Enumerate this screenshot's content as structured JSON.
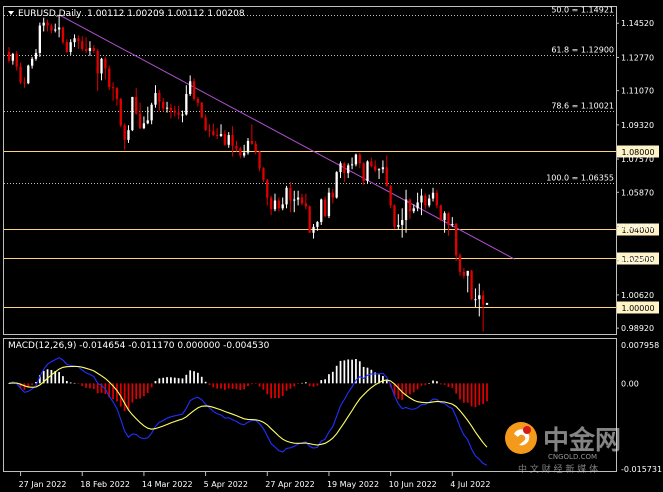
{
  "colors": {
    "background": "#000000",
    "axis": "#bfbfbf",
    "bull_candle": "#ffffff",
    "bear_candle": "#e00000",
    "fib_line": "#bfbfbf",
    "sr_line": "#ffd27a",
    "trendline": "#b050d0",
    "macd_hist_pos": "#ffffff",
    "macd_hist_neg": "#e00000",
    "macd_line": "#2030ff",
    "signal_line": "#ffff66",
    "logo_orange": "#f39a1a",
    "logo_red": "#d61a1a"
  },
  "price_panel": {
    "header": "EURUSD,Daily  1.00112 1.00209 1.00112 1.00208",
    "y_ticks": [
      "1.14520",
      "1.12770",
      "1.11070",
      "1.09320",
      "1.07570",
      "1.05870",
      "1.04120",
      "1.02370",
      "1.00620",
      "0.98920"
    ]
  },
  "macd_panel": {
    "header": "MACD(12,26,9) -0.014654 -0.011170 0.000000 -0.004530",
    "y_ticks": [
      "0.007958",
      "0.00",
      "-0.015731"
    ]
  },
  "x_ticks": [
    "27 Jan 2022",
    "18 Feb 2022",
    "14 Mar 2022",
    "5 Apr 2022",
    "27 Apr 2022",
    "19 May 2022",
    "10 Jun 2022",
    "4 Jul 2022"
  ],
  "fib_levels": [
    {
      "label": "50.0 = 1.14921",
      "value": 1.14921
    },
    {
      "label": "61.8 = 1.12900",
      "value": 1.129
    },
    {
      "label": "78.6 = 1.10021",
      "value": 1.10021
    },
    {
      "label": "100.0 = 1.06355",
      "value": 1.06355
    }
  ],
  "sr_levels": [
    {
      "label": "1.08000",
      "value": 1.08
    },
    {
      "label": "1.04000",
      "value": 1.04
    },
    {
      "label": "1.02500",
      "value": 1.025
    },
    {
      "label": "1.00000",
      "value": 1.0
    }
  ],
  "watermark": {
    "brand": "中金网",
    "domain": "CNGOLD.COM",
    "tagline": "中 文 财 经 新 媒 体"
  },
  "chart_data": {
    "type": "candlestick",
    "symbol": "EURUSD",
    "timeframe": "Daily",
    "last_ohlc": {
      "open": 1.00112,
      "high": 1.00209,
      "low": 1.00112,
      "close": 1.00208
    },
    "price_range": [
      0.9862,
      1.1535
    ],
    "trendline": {
      "from": {
        "date": "2022-02-10",
        "price": 1.1495
      },
      "to": {
        "date": "2022-07-25",
        "price": 1.0245
      }
    },
    "candles": [
      [
        "2022-01-24",
        1.1305,
        1.133,
        1.125,
        1.126
      ],
      [
        "2022-01-25",
        1.126,
        1.13,
        1.124,
        1.1295
      ],
      [
        "2022-01-26",
        1.1295,
        1.131,
        1.121,
        1.123
      ],
      [
        "2022-01-27",
        1.123,
        1.125,
        1.114,
        1.115
      ],
      [
        "2022-01-28",
        1.115,
        1.1175,
        1.1122,
        1.1145
      ],
      [
        "2022-01-31",
        1.1145,
        1.124,
        1.114,
        1.1235
      ],
      [
        "2022-02-01",
        1.1235,
        1.128,
        1.122,
        1.127
      ],
      [
        "2022-02-02",
        1.127,
        1.132,
        1.126,
        1.13
      ],
      [
        "2022-02-03",
        1.13,
        1.1455,
        1.128,
        1.144
      ],
      [
        "2022-02-04",
        1.144,
        1.148,
        1.141,
        1.1455
      ],
      [
        "2022-02-07",
        1.1455,
        1.147,
        1.141,
        1.144
      ],
      [
        "2022-02-08",
        1.144,
        1.145,
        1.14,
        1.1415
      ],
      [
        "2022-02-09",
        1.1415,
        1.145,
        1.1405,
        1.142
      ],
      [
        "2022-02-10",
        1.142,
        1.1495,
        1.138,
        1.143
      ],
      [
        "2022-02-11",
        1.143,
        1.1435,
        1.1345,
        1.1355
      ],
      [
        "2022-02-14",
        1.1355,
        1.137,
        1.13,
        1.1305
      ],
      [
        "2022-02-15",
        1.1305,
        1.137,
        1.129,
        1.1355
      ],
      [
        "2022-02-16",
        1.1355,
        1.1395,
        1.133,
        1.1375
      ],
      [
        "2022-02-17",
        1.1375,
        1.139,
        1.132,
        1.136
      ],
      [
        "2022-02-18",
        1.136,
        1.1385,
        1.131,
        1.132
      ],
      [
        "2022-02-21",
        1.132,
        1.138,
        1.13,
        1.131
      ],
      [
        "2022-02-22",
        1.131,
        1.136,
        1.1285,
        1.1325
      ],
      [
        "2022-02-23",
        1.1325,
        1.134,
        1.13,
        1.131
      ],
      [
        "2022-02-24",
        1.131,
        1.132,
        1.1105,
        1.1195
      ],
      [
        "2022-02-25",
        1.1195,
        1.1275,
        1.116,
        1.127
      ],
      [
        "2022-02-28",
        1.127,
        1.128,
        1.1165,
        1.122
      ],
      [
        "2022-03-01",
        1.122,
        1.1235,
        1.111,
        1.1125
      ],
      [
        "2022-03-02",
        1.1125,
        1.115,
        1.1055,
        1.112
      ],
      [
        "2022-03-03",
        1.112,
        1.1125,
        1.103,
        1.1065
      ],
      [
        "2022-03-04",
        1.1065,
        1.107,
        1.092,
        1.093
      ],
      [
        "2022-03-07",
        1.093,
        1.094,
        1.0805,
        1.0855
      ],
      [
        "2022-03-08",
        1.0855,
        1.093,
        1.084,
        1.0905
      ],
      [
        "2022-03-09",
        1.0905,
        1.1075,
        1.09,
        1.1075
      ],
      [
        "2022-03-10",
        1.1075,
        1.112,
        1.0985,
        1.099
      ],
      [
        "2022-03-11",
        1.099,
        1.1045,
        1.091,
        1.0915
      ],
      [
        "2022-03-14",
        1.0915,
        1.0975,
        1.091,
        1.094
      ],
      [
        "2022-03-15",
        1.094,
        1.1025,
        1.0935,
        1.0955
      ],
      [
        "2022-03-16",
        1.0955,
        1.1045,
        1.0935,
        1.1035
      ],
      [
        "2022-03-17",
        1.1035,
        1.1135,
        1.102,
        1.1095
      ],
      [
        "2022-03-18",
        1.1095,
        1.111,
        1.1005,
        1.105
      ],
      [
        "2022-03-21",
        1.105,
        1.107,
        1.1,
        1.1015
      ],
      [
        "2022-03-22",
        1.1015,
        1.105,
        1.0995,
        1.102
      ],
      [
        "2022-03-23",
        1.102,
        1.104,
        1.0965,
        1.1005
      ],
      [
        "2022-03-24",
        1.1005,
        1.103,
        1.0975,
        1.0995
      ],
      [
        "2022-03-25",
        1.0995,
        1.103,
        1.096,
        1.0985
      ],
      [
        "2022-03-28",
        1.0985,
        1.1005,
        1.0945,
        1.0985
      ],
      [
        "2022-03-29",
        1.0985,
        1.1135,
        1.098,
        1.109
      ],
      [
        "2022-03-30",
        1.109,
        1.1185,
        1.108,
        1.1155
      ],
      [
        "2022-03-31",
        1.1155,
        1.117,
        1.1055,
        1.1065
      ],
      [
        "2022-04-01",
        1.1065,
        1.1075,
        1.1025,
        1.1045
      ],
      [
        "2022-04-04",
        1.1045,
        1.105,
        1.0965,
        1.097
      ],
      [
        "2022-04-05",
        1.097,
        1.0985,
        1.09,
        1.0905
      ],
      [
        "2022-04-06",
        1.0905,
        1.0935,
        1.087,
        1.09
      ],
      [
        "2022-04-07",
        1.09,
        1.094,
        1.0875,
        1.088
      ],
      [
        "2022-04-08",
        1.088,
        1.0915,
        1.086,
        1.0875
      ],
      [
        "2022-04-11",
        1.0875,
        1.0935,
        1.087,
        1.0885
      ],
      [
        "2022-04-12",
        1.0885,
        1.0905,
        1.0825,
        1.083
      ],
      [
        "2022-04-13",
        1.083,
        1.0895,
        1.0815,
        1.088
      ],
      [
        "2022-04-14",
        1.088,
        1.0925,
        1.077,
        1.0825
      ],
      [
        "2022-04-15",
        1.0825,
        1.085,
        1.0795,
        1.081
      ],
      [
        "2022-04-18",
        1.081,
        1.082,
        1.076,
        1.0775
      ],
      [
        "2022-04-19",
        1.0775,
        1.083,
        1.0765,
        1.079
      ],
      [
        "2022-04-20",
        1.079,
        1.0865,
        1.078,
        1.085
      ],
      [
        "2022-04-21",
        1.085,
        1.0935,
        1.083,
        1.0835
      ],
      [
        "2022-04-22",
        1.0835,
        1.085,
        1.078,
        1.0795
      ],
      [
        "2022-04-25",
        1.0795,
        1.08,
        1.0695,
        1.071
      ],
      [
        "2022-04-26",
        1.071,
        1.0715,
        1.064,
        1.065
      ],
      [
        "2022-04-27",
        1.065,
        1.0655,
        1.052,
        1.056
      ],
      [
        "2022-04-28",
        1.056,
        1.057,
        1.047,
        1.05
      ],
      [
        "2022-04-29",
        1.05,
        1.058,
        1.049,
        1.0545
      ],
      [
        "2022-05-02",
        1.0545,
        1.056,
        1.049,
        1.0505
      ],
      [
        "2022-05-03",
        1.0505,
        1.056,
        1.0495,
        1.0525
      ],
      [
        "2022-05-04",
        1.0525,
        1.062,
        1.0505,
        1.061
      ],
      [
        "2022-05-05",
        1.061,
        1.064,
        1.0485,
        1.0545
      ],
      [
        "2022-05-06",
        1.0545,
        1.0595,
        1.0485,
        1.055
      ],
      [
        "2022-05-09",
        1.055,
        1.0595,
        1.052,
        1.056
      ],
      [
        "2022-05-10",
        1.056,
        1.058,
        1.052,
        1.053
      ],
      [
        "2022-05-11",
        1.053,
        1.058,
        1.05,
        1.0515
      ],
      [
        "2022-05-12",
        1.0515,
        1.052,
        1.038,
        1.038
      ],
      [
        "2022-05-13",
        1.038,
        1.0425,
        1.035,
        1.041
      ],
      [
        "2022-05-16",
        1.041,
        1.044,
        1.039,
        1.0435
      ],
      [
        "2022-05-17",
        1.0435,
        1.0555,
        1.042,
        1.055
      ],
      [
        "2022-05-18",
        1.055,
        1.0565,
        1.046,
        1.0465
      ],
      [
        "2022-05-19",
        1.0465,
        1.061,
        1.0455,
        1.0585
      ],
      [
        "2022-05-20",
        1.0585,
        1.0605,
        1.053,
        1.056
      ],
      [
        "2022-05-23",
        1.056,
        1.0695,
        1.0555,
        1.069
      ],
      [
        "2022-05-24",
        1.069,
        1.0745,
        1.066,
        1.0735
      ],
      [
        "2022-05-25",
        1.0735,
        1.074,
        1.064,
        1.0685
      ],
      [
        "2022-05-26",
        1.0685,
        1.0735,
        1.066,
        1.0725
      ],
      [
        "2022-05-27",
        1.0725,
        1.0765,
        1.0705,
        1.073
      ],
      [
        "2022-05-30",
        1.073,
        1.0785,
        1.072,
        1.078
      ],
      [
        "2022-05-31",
        1.078,
        1.079,
        1.071,
        1.0735
      ],
      [
        "2022-06-01",
        1.0735,
        1.074,
        1.0625,
        1.0645
      ],
      [
        "2022-06-02",
        1.0645,
        1.075,
        1.063,
        1.0745
      ],
      [
        "2022-06-03",
        1.0745,
        1.0765,
        1.0715,
        1.072
      ],
      [
        "2022-06-06",
        1.072,
        1.075,
        1.069,
        1.07
      ],
      [
        "2022-06-07",
        1.07,
        1.071,
        1.0655,
        1.0705
      ],
      [
        "2022-06-08",
        1.0705,
        1.075,
        1.0685,
        1.0715
      ],
      [
        "2022-06-09",
        1.0715,
        1.0775,
        1.0615,
        1.062
      ],
      [
        "2022-06-10",
        1.062,
        1.0625,
        1.0505,
        1.052
      ],
      [
        "2022-06-13",
        1.052,
        1.0525,
        1.04,
        1.041
      ],
      [
        "2022-06-14",
        1.041,
        1.0475,
        1.0395,
        1.042
      ],
      [
        "2022-06-15",
        1.042,
        1.0505,
        1.0355,
        1.0445
      ],
      [
        "2022-06-16",
        1.0445,
        1.06,
        1.038,
        1.055
      ],
      [
        "2022-06-17",
        1.055,
        1.0555,
        1.045,
        1.049
      ],
      [
        "2022-06-20",
        1.049,
        1.0525,
        1.048,
        1.0505
      ],
      [
        "2022-06-21",
        1.0505,
        1.0585,
        1.049,
        1.0535
      ],
      [
        "2022-06-22",
        1.0535,
        1.0605,
        1.047,
        1.057
      ],
      [
        "2022-06-23",
        1.057,
        1.058,
        1.05,
        1.052
      ],
      [
        "2022-06-24",
        1.052,
        1.0575,
        1.051,
        1.0555
      ],
      [
        "2022-06-27",
        1.0555,
        1.061,
        1.054,
        1.0585
      ],
      [
        "2022-06-28",
        1.0585,
        1.06,
        1.0505,
        1.052
      ],
      [
        "2022-06-29",
        1.052,
        1.0525,
        1.044,
        1.0445
      ],
      [
        "2022-06-30",
        1.0445,
        1.049,
        1.038,
        1.048
      ],
      [
        "2022-07-01",
        1.048,
        1.0485,
        1.0365,
        1.042
      ],
      [
        "2022-07-04",
        1.042,
        1.046,
        1.041,
        1.0425
      ],
      [
        "2022-07-05",
        1.0425,
        1.043,
        1.0235,
        1.0265
      ],
      [
        "2022-07-06",
        1.0265,
        1.0275,
        1.016,
        1.018
      ],
      [
        "2022-07-07",
        1.018,
        1.02,
        1.0145,
        1.016
      ],
      [
        "2022-07-08",
        1.016,
        1.0185,
        1.0075,
        1.0185
      ],
      [
        "2022-07-11",
        1.0185,
        1.019,
        1.0035,
        1.004
      ],
      [
        "2022-07-12",
        1.004,
        1.0095,
        1.0,
        1.004
      ],
      [
        "2022-07-13",
        1.004,
        1.012,
        0.9952,
        1.006
      ],
      [
        "2022-07-14",
        1.006,
        1.0085,
        0.9875,
        1.0012
      ],
      [
        "2022-07-15",
        1.0011,
        1.0021,
        1.0011,
        1.0021
      ]
    ],
    "macd": {
      "name": "MACD(12,26,9)",
      "macd_line": -0.014654,
      "signal_line": -0.01117,
      "histogram": -0.00453,
      "y_range": [
        -0.015731,
        0.007958
      ]
    }
  }
}
